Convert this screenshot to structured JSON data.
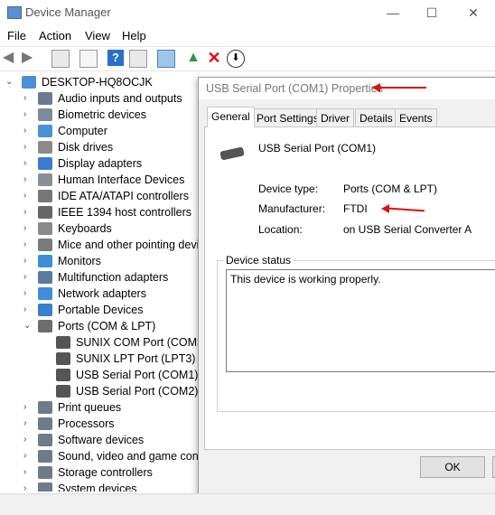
{
  "window": {
    "title": "Device Manager"
  },
  "menu": [
    "File",
    "Action",
    "View",
    "Help"
  ],
  "tree": {
    "root": "DESKTOP-HQ8OCJK",
    "categories": [
      "Audio inputs and outputs",
      "Biometric devices",
      "Computer",
      "Disk drives",
      "Display adapters",
      "Human Interface Devices",
      "IDE ATA/ATAPI controllers",
      "IEEE 1394 host controllers",
      "Keyboards",
      "Mice and other pointing devic",
      "Monitors",
      "Multifunction adapters",
      "Network adapters",
      "Portable Devices",
      "Ports (COM & LPT)"
    ],
    "ports_children": [
      "SUNIX COM Port (COM3)",
      "SUNIX LPT Port (LPT3)",
      "USB Serial Port (COM1)",
      "USB Serial Port (COM2)"
    ],
    "after": [
      "Print queues",
      "Processors",
      "Software devices",
      "Sound, video and game contr",
      "Storage controllers",
      "System devices"
    ]
  },
  "dialog": {
    "title": "USB Serial Port (COM1) Properties",
    "tabs": [
      "General",
      "Port Settings",
      "Driver",
      "Details",
      "Events"
    ],
    "device_name": "USB Serial Port (COM1)",
    "device_type_label": "Device type:",
    "device_type": "Ports (COM & LPT)",
    "manufacturer_label": "Manufacturer:",
    "manufacturer": "FTDI",
    "location_label": "Location:",
    "location": "on USB Serial Converter A",
    "status_label": "Device status",
    "status_text": "This device is working properly.",
    "ok": "OK"
  },
  "colors": {
    "annotation_arrow": "#dd1111",
    "icon_blue": "#2a6fc9"
  }
}
